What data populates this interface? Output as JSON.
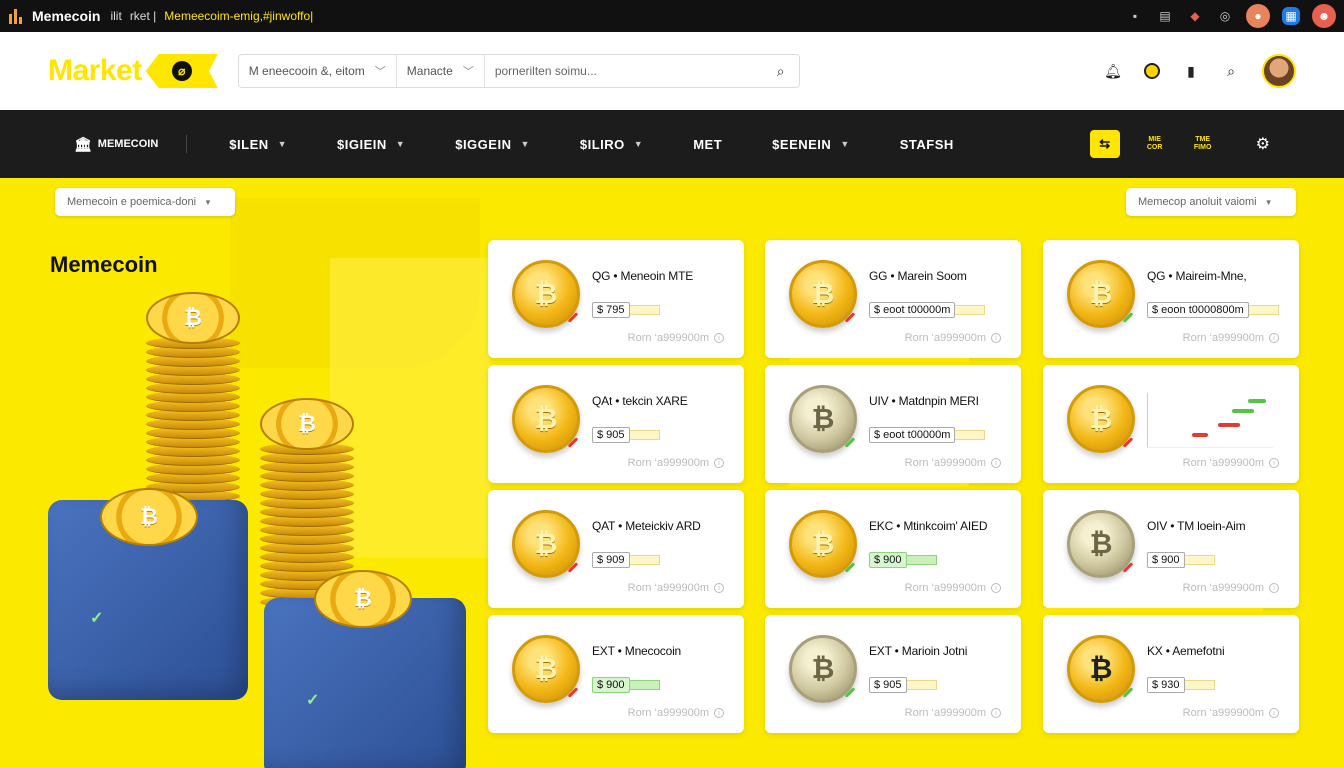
{
  "titlebar": {
    "app_name": "Memecoin",
    "tabs": [
      "ilit",
      "rket |",
      "Memeecoim-emig,#jinwoffo|"
    ],
    "icons": [
      "minimize-icon",
      "clipboard-icon",
      "extension-icon",
      "settings-icon",
      "profile-icon",
      "grid-icon",
      "account-icon"
    ]
  },
  "header": {
    "logo_text": "Market",
    "search": {
      "category": "M  eneecooin &, eitom",
      "filter": "Manacte",
      "placeholder": "pornerilten soimu..."
    }
  },
  "nav": {
    "brand": "MEMECOIN",
    "items": [
      {
        "label": "$ILEN",
        "has_dropdown": true
      },
      {
        "label": "$IGIEIN",
        "has_dropdown": true
      },
      {
        "label": "$IGGEIN",
        "has_dropdown": true
      },
      {
        "label": "$ILIRO",
        "has_dropdown": true
      },
      {
        "label": "MET",
        "has_dropdown": false
      },
      {
        "label": "$EENEIN",
        "has_dropdown": true
      },
      {
        "label": "STAFSH",
        "has_dropdown": false
      }
    ],
    "mini_labels": [
      "MIE\nCOR",
      "TME\nFIMO"
    ]
  },
  "main": {
    "left_dropdown": "Memecoin e poemica-doni",
    "right_dropdown": "Memecop anoluit vaiomi",
    "section_title": "Memecoin",
    "cards": [
      {
        "name": "QG • Meneoin MTE",
        "price": "$ 795",
        "meta": "Rorn ‘a999900m",
        "coin": "gold",
        "mark": "red",
        "green": false
      },
      {
        "name": "GG • Marein Soom",
        "price": "$ eoot t00000m",
        "meta": "Rorn ‘a999900m",
        "coin": "gold",
        "mark": "red",
        "green": false
      },
      {
        "name": "QG • Maireim-Mne,",
        "price": "$ eoon t0000800m",
        "meta": "Rorn ‘a999900m",
        "coin": "gold",
        "mark": "green",
        "green": false
      },
      {
        "name": "QAt • tekcin XARE",
        "price": "$ 905",
        "meta": "Rorn ‘a999900m",
        "coin": "gold",
        "mark": "red",
        "green": false
      },
      {
        "name": "UIV • Matdnpin MERI",
        "price": "$ eoot t00000m",
        "meta": "Rorn ‘a999900m",
        "coin": "silver",
        "mark": "green",
        "green": false
      },
      {
        "name": "",
        "price": "",
        "meta": "Rorn ‘a999900m",
        "coin": "gold",
        "mark": "red",
        "green": false,
        "chart": true
      },
      {
        "name": "QAT • Meteickiv ARD",
        "price": "$ 909",
        "meta": "Rorn ‘a999900m",
        "coin": "gold",
        "mark": "red",
        "green": false
      },
      {
        "name": "EKC • Mtinkcoim' AIED",
        "price": "$ 900",
        "meta": "Rorn ‘a999900m",
        "coin": "gold",
        "mark": "green",
        "green": true
      },
      {
        "name": "OIV • TM loein-Aim",
        "price": "$ 900",
        "meta": "Rorn ‘a999900m",
        "coin": "silver",
        "mark": "red",
        "green": false
      },
      {
        "name": "EXT • Mnecocoin",
        "price": "$ 900",
        "meta": "Rorn ‘a999900m",
        "coin": "gold",
        "mark": "red",
        "green": true
      },
      {
        "name": "EXT • Marioin Jotni",
        "price": "$ 905",
        "meta": "Rorn ‘a999900m",
        "coin": "silver",
        "mark": "green",
        "green": false
      },
      {
        "name": "KX • Aemefotni",
        "price": "$ 930",
        "meta": "Rorn ‘a999900m",
        "coin": "dark",
        "mark": "green",
        "green": false
      }
    ]
  },
  "colors": {
    "brand_yellow": "#ffe600",
    "nav_bg": "#1c1c1c",
    "cube_blue": "#3a62ad"
  }
}
